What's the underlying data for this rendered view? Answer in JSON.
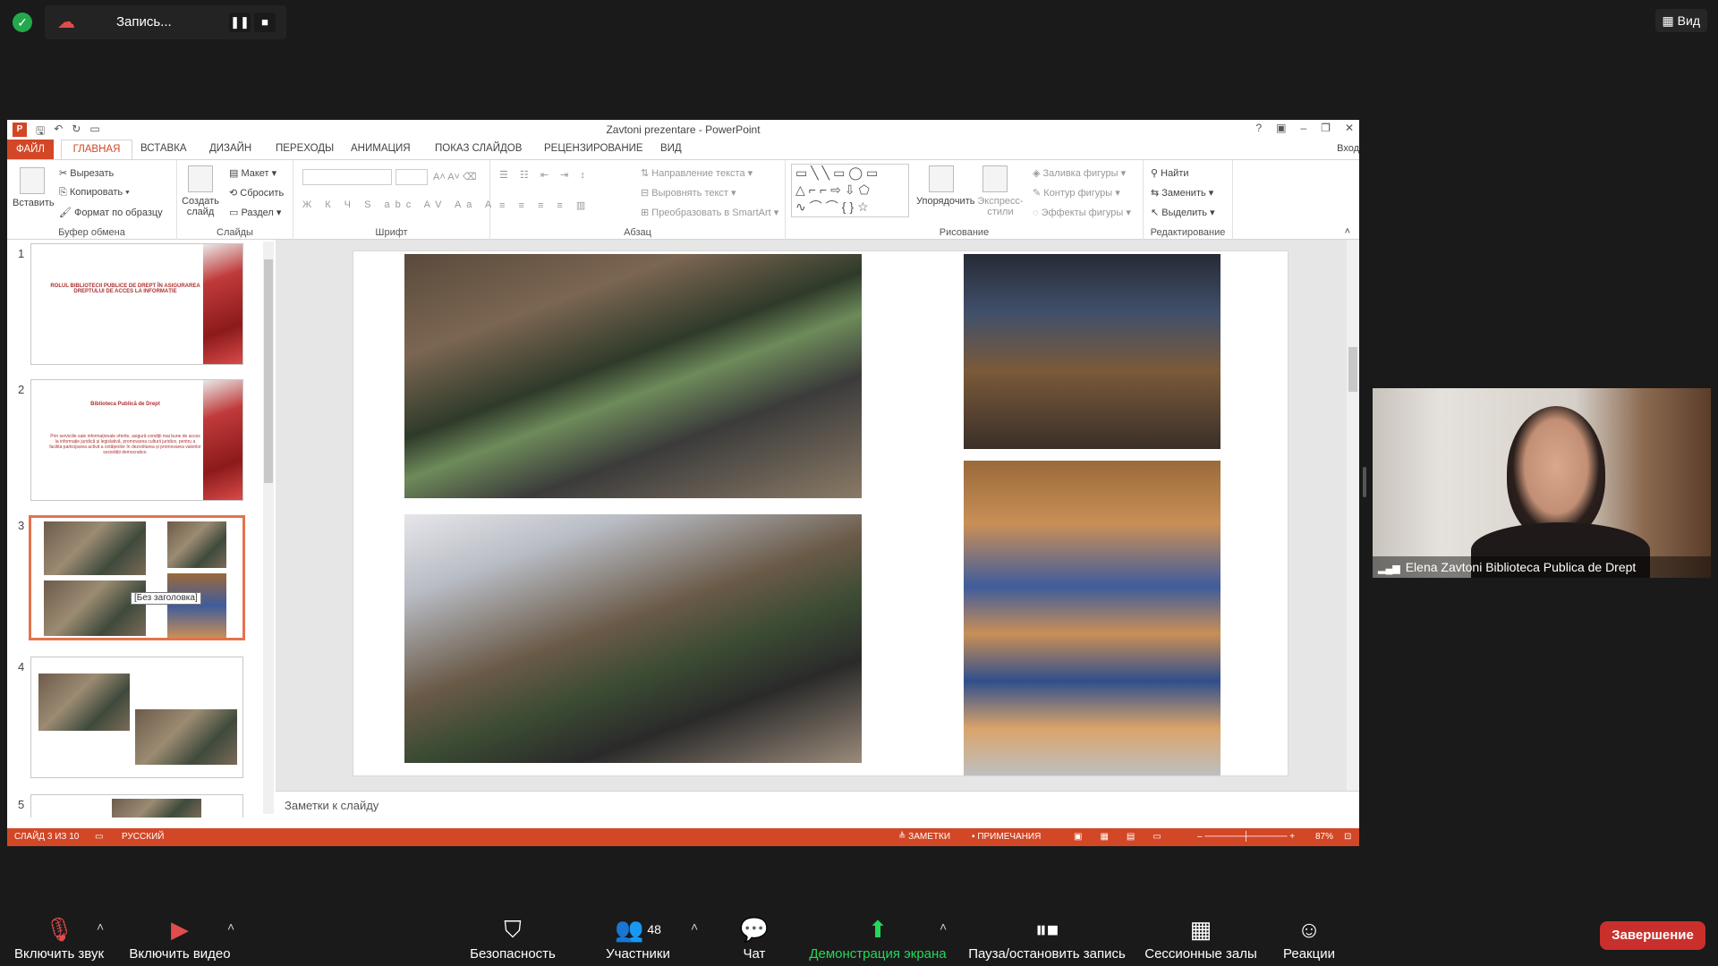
{
  "zoom_top": {
    "recording_label": "Запись...",
    "pause_icon": "❚❚",
    "stop_icon": "■",
    "view_label": "Вид"
  },
  "ppt": {
    "window_title": "Zavtoni prezentare - PowerPoint",
    "signin": "Вход",
    "tabs": [
      "ФАЙЛ",
      "ГЛАВНАЯ",
      "ВСТАВКА",
      "ДИЗАЙН",
      "ПЕРЕХОДЫ",
      "АНИМАЦИЯ",
      "ПОКАЗ СЛАЙДОВ",
      "РЕЦЕНЗИРОВАНИЕ",
      "ВИД"
    ],
    "ribbon": {
      "clipboard": {
        "paste": "Вставить",
        "cut": "Вырезать",
        "copy": "Копировать",
        "format_painter": "Формат по образцу",
        "label": "Буфер обмена"
      },
      "slides": {
        "new_slide": "Создать слайд",
        "layout": "Макет",
        "reset": "Сбросить",
        "section": "Раздел",
        "label": "Слайды"
      },
      "font": {
        "label": "Шрифт"
      },
      "paragraph": {
        "text_direction": "Направление текста",
        "align_text": "Выровнять текст",
        "smartart": "Преобразовать в SmartArt",
        "label": "Абзац"
      },
      "drawing": {
        "arrange": "Упорядочить",
        "quick_styles": "Экспресс-стили",
        "shape_fill": "Заливка фигуры",
        "shape_outline": "Контур фигуры",
        "shape_effects": "Эффекты фигуры",
        "label": "Рисование"
      },
      "editing": {
        "find": "Найти",
        "replace": "Заменить",
        "select": "Выделить",
        "label": "Редактирование"
      }
    },
    "thumbnails": [
      {
        "num": "1",
        "title": "ROLUL BIBLIOTECII PUBLICE DE DREPT ÎN ASIGURAREA DREPTULUI DE ACCES LA INFORMAȚIE"
      },
      {
        "num": "2",
        "title": "Biblioteca Publică de Drept",
        "body": "Prin serviciile sale informaționale oferite, asigură condiții mai bune de acces la informație juridică și legislativă, promovarea culturii juridice, pentru a facilita participarea activă a cetățenilor în dezvoltarea și promovarea valorilor societății democratice."
      },
      {
        "num": "3"
      },
      {
        "num": "4"
      },
      {
        "num": "5"
      }
    ],
    "tooltip": "[Без заголовка]",
    "notes_placeholder": "Заметки к слайду",
    "status": {
      "slide_info": "СЛАЙД 3 ИЗ 10",
      "language": "РУССКИЙ",
      "notes": "ЗАМЕТКИ",
      "comments": "ПРИМЕЧАНИЯ",
      "zoom": "87%"
    }
  },
  "participant": {
    "name": "Elena Zavtoni Biblioteca Publica de Drept"
  },
  "toolbar": {
    "unmute": "Включить звук",
    "start_video": "Включить видео",
    "security": "Безопасность",
    "participants": "Участники",
    "participants_count": "48",
    "chat": "Чат",
    "share_screen": "Демонстрация экрана",
    "pause_record": "Пауза/остановить запись",
    "breakout": "Сессионные залы",
    "reactions": "Реакции",
    "end": "Завершение"
  },
  "colors": {
    "accent": "#d24726",
    "zoom_green": "#23d959",
    "end_red": "#c9302c"
  }
}
